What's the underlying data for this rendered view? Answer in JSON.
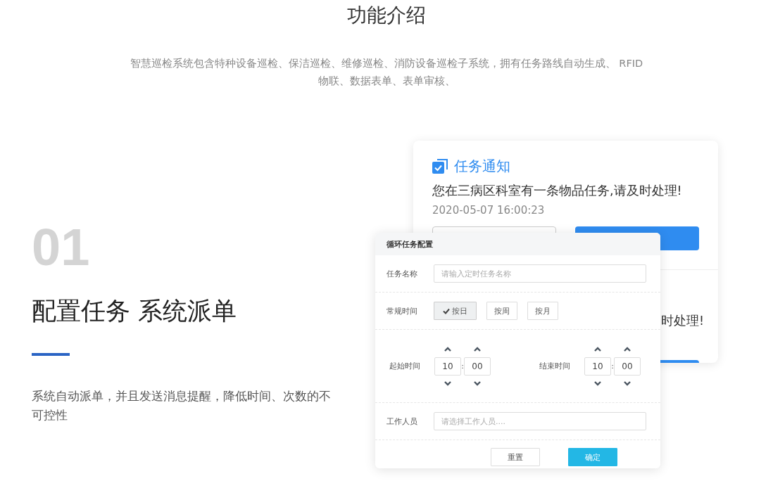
{
  "title": "功能介绍",
  "intro": "智慧巡检系统包含特种设备巡检、保洁巡检、维修巡检、消防设备巡检子系统，拥有任务路线自动生成、 RFID物联、数据表单、表单审核、",
  "feature": {
    "number": "01",
    "heading": "配置任务 系统派单",
    "description": "系统自动派单，并且发送消息提醒，降低时间、次数的不可控性"
  },
  "notification": {
    "title": "任务通知",
    "message": "您在三病区科室有一条物品任务,请及时处理!",
    "time": "2020-05-07 16:00:23",
    "second_message": "时处理!"
  },
  "dialog": {
    "title": "循环任务配置",
    "fields": [
      {
        "kind": "text",
        "label": "任务名称",
        "placeholder": "请输入定时任务名称"
      },
      {
        "kind": "options",
        "label": "常规时间",
        "options": [
          {
            "label": "按日",
            "selected": true
          },
          {
            "label": "按周",
            "selected": false
          },
          {
            "label": "按月",
            "selected": false
          }
        ]
      },
      {
        "kind": "times",
        "times": [
          {
            "label": "起始时间",
            "hour": "10",
            "separator": ":",
            "minute": "00"
          },
          {
            "label": "结束时间",
            "hour": "10",
            "separator": ":",
            "minute": "00"
          }
        ]
      },
      {
        "kind": "text",
        "label": "工作人员",
        "placeholder": "请选择工作人员...."
      }
    ],
    "buttons": [
      {
        "label": "重置",
        "kind": "default"
      },
      {
        "label": "确定",
        "kind": "primary"
      }
    ]
  }
}
